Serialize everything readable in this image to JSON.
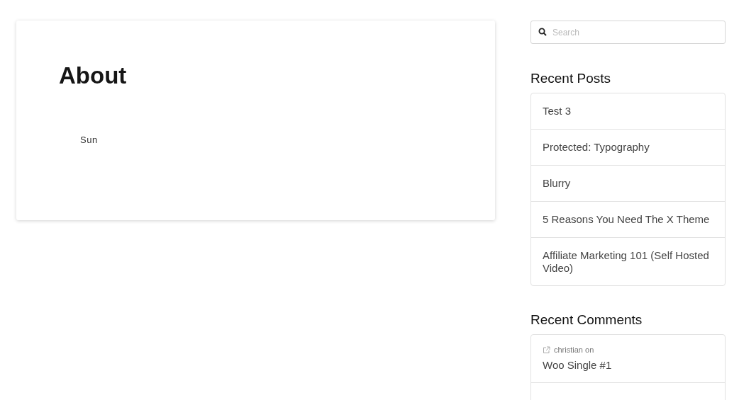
{
  "article": {
    "title": "About",
    "body": "Sun"
  },
  "search": {
    "placeholder": "Search"
  },
  "recent_posts": {
    "heading": "Recent Posts",
    "items": [
      {
        "title": "Test 3"
      },
      {
        "title": "Protected: Typography"
      },
      {
        "title": "Blurry"
      },
      {
        "title": "5 Reasons You Need The X Theme"
      },
      {
        "title": "Affiliate Marketing 101 (Self Hosted Video)"
      }
    ]
  },
  "recent_comments": {
    "heading": "Recent Comments",
    "items": [
      {
        "author": "christian on",
        "post": "Woo Single #1"
      }
    ]
  }
}
